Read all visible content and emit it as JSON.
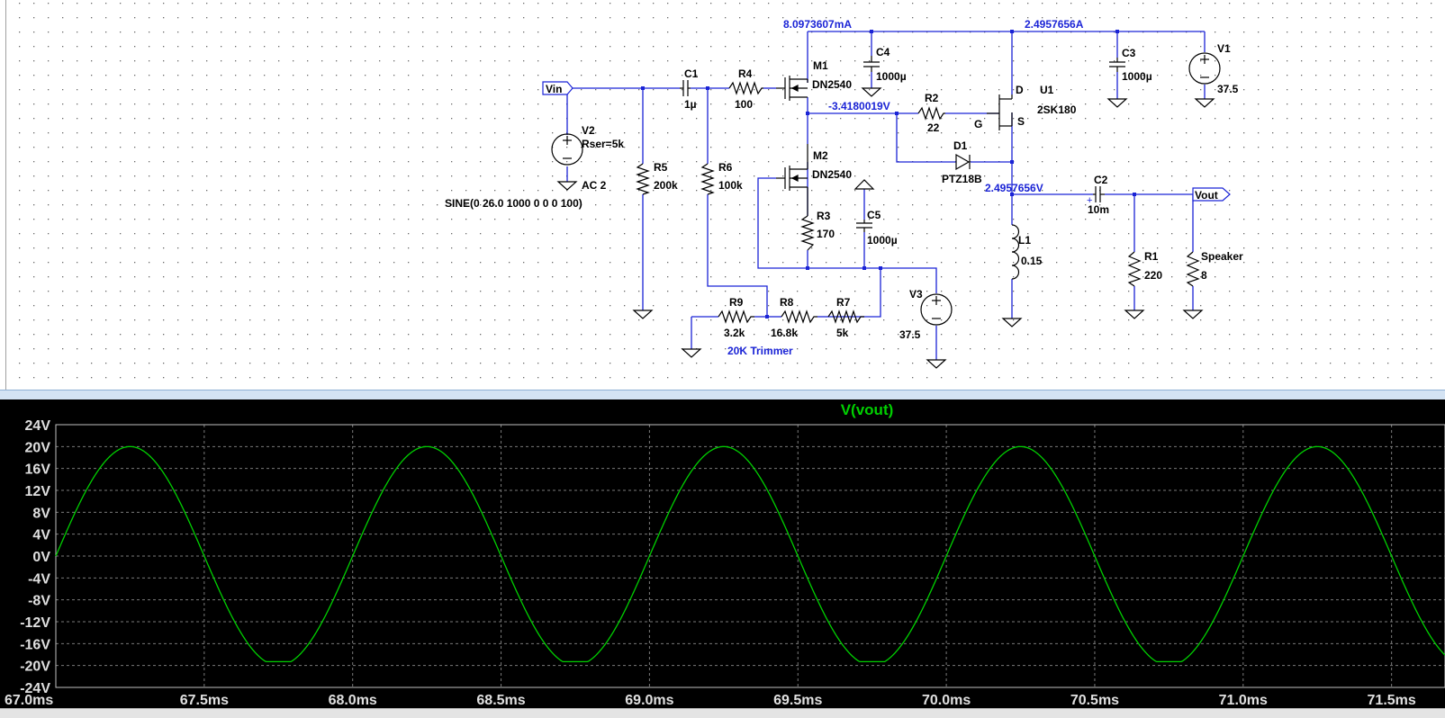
{
  "schematic": {
    "node_labels": {
      "vin": "Vin",
      "vout": "Vout"
    },
    "operating_point": {
      "m1_drain_current": "8.0973607mA",
      "supply_current": "2.4957656A",
      "source_node_voltage": "-3.4180019V",
      "output_node_voltage": "2.4957656V"
    },
    "components": {
      "v1": {
        "name": "V1",
        "value": "37.5"
      },
      "v2": {
        "name": "V2",
        "param": "Rser=5k",
        "ac": "AC 2",
        "sine": "SINE(0 26.0 1000 0 0 0 100)"
      },
      "v3": {
        "name": "V3",
        "value": "37.5"
      },
      "c1": {
        "name": "C1",
        "value": "1µ"
      },
      "c2": {
        "name": "C2",
        "value": "10m"
      },
      "c3": {
        "name": "C3",
        "value": "1000µ"
      },
      "c4": {
        "name": "C4",
        "value": "1000µ"
      },
      "c5": {
        "name": "C5",
        "value": "1000µ"
      },
      "r1": {
        "name": "R1",
        "value": "220"
      },
      "r2": {
        "name": "R2",
        "value": "22"
      },
      "r3": {
        "name": "R3",
        "value": "170"
      },
      "r4": {
        "name": "R4",
        "value": "100"
      },
      "r5": {
        "name": "R5",
        "value": "200k"
      },
      "r6": {
        "name": "R6",
        "value": "100k"
      },
      "r7": {
        "name": "R7",
        "value": "5k"
      },
      "r8": {
        "name": "R8",
        "value": "16.8k"
      },
      "r9": {
        "name": "R9",
        "value": "3.2k"
      },
      "m1": {
        "name": "M1",
        "value": "DN2540"
      },
      "m2": {
        "name": "M2",
        "value": "DN2540"
      },
      "u1": {
        "name": "U1",
        "value": "2SK180",
        "pin_d": "D",
        "pin_g": "G",
        "pin_s": "S"
      },
      "d1": {
        "name": "D1",
        "value": "PTZ18B"
      },
      "l1": {
        "name": "L1",
        "value": "0.15"
      },
      "speaker": {
        "name": "Speaker",
        "value": "8"
      }
    },
    "trimmer_label": "20K Trimmer"
  },
  "chart_data": {
    "type": "line",
    "title": "V(vout)",
    "xlabel": "",
    "ylabel": "",
    "x_ticks": [
      "67.0ms",
      "67.5ms",
      "68.0ms",
      "68.5ms",
      "69.0ms",
      "69.5ms",
      "70.0ms",
      "70.5ms",
      "71.0ms",
      "71.5ms"
    ],
    "y_ticks": [
      "24V",
      "20V",
      "16V",
      "12V",
      "8V",
      "4V",
      "0V",
      "-4V",
      "-8V",
      "-12V",
      "-16V",
      "-20V",
      "-24V"
    ],
    "xlim": [
      67.0,
      71.68
    ],
    "ylim": [
      -24,
      24
    ],
    "grid": true,
    "series": [
      {
        "name": "V(vout)",
        "color": "#00d000",
        "waveform": "sine",
        "amplitude": 20.0,
        "clip_low": -19.3,
        "frequency_hz": 1000,
        "phase_zero_ms": 67.0
      }
    ]
  },
  "colors": {
    "wire": "#1b24d6",
    "component": "#000000",
    "trace": "#00d000",
    "plot_bg": "#000000",
    "title": "#00d000"
  }
}
